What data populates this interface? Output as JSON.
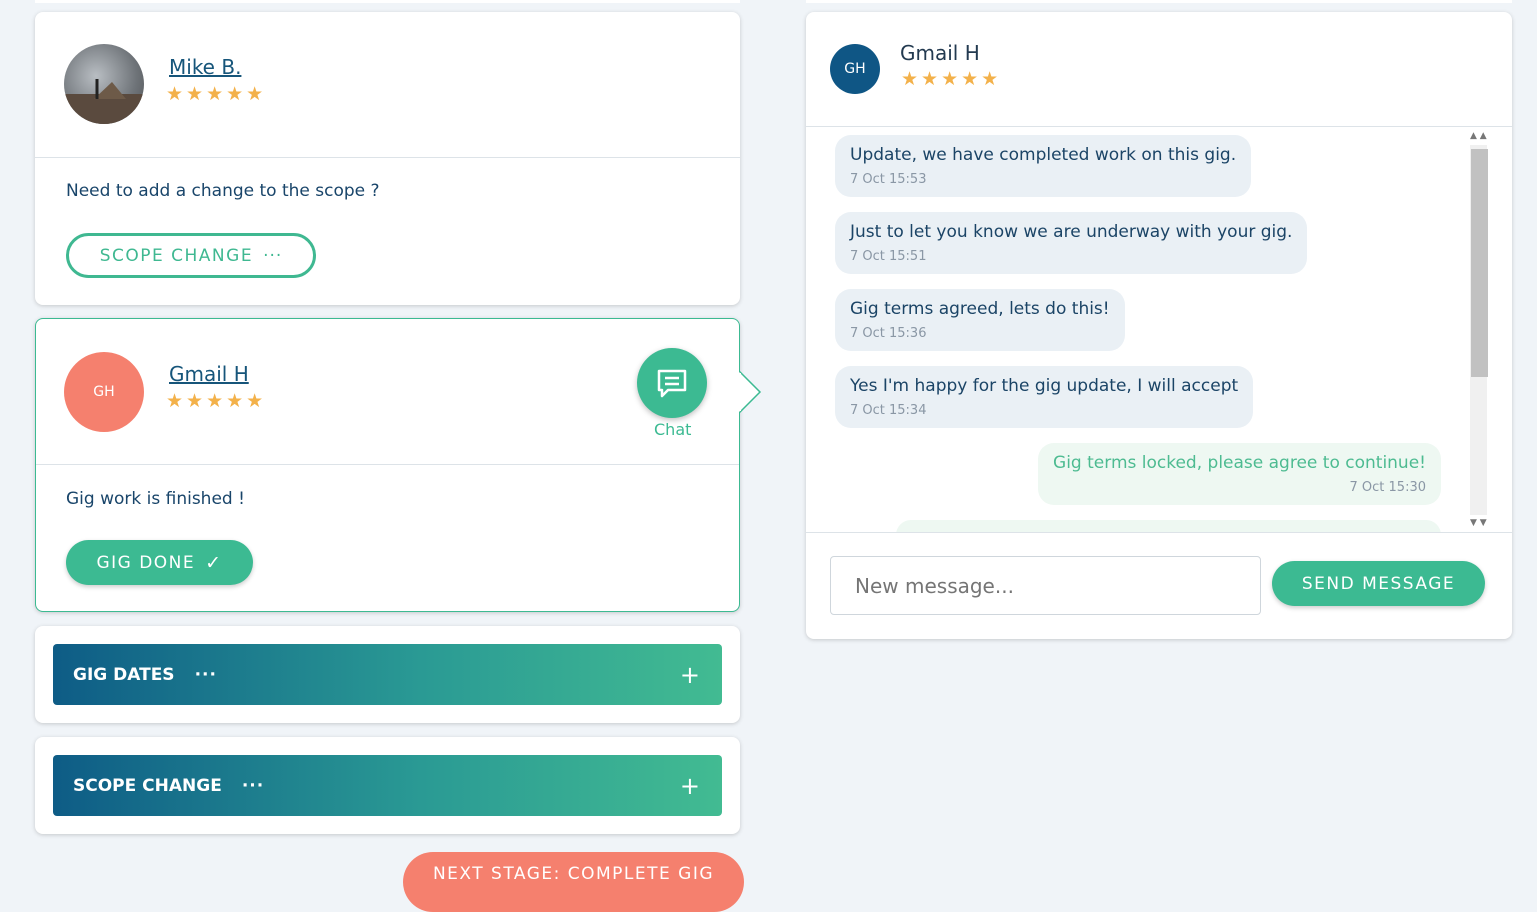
{
  "user_card": {
    "name": "Mike B.",
    "stars": "★★★★★",
    "prompt": "Need to add a change to the scope ?",
    "button_label": "SCOPE CHANGE",
    "button_dots": "···"
  },
  "gig_card": {
    "avatar_initials": "GH",
    "name": "Gmail H",
    "stars": "★★★★★",
    "chat_label": "Chat",
    "status": "Gig work is finished !",
    "button_label": "GIG DONE",
    "button_check": "✓"
  },
  "sections": [
    {
      "label": "GIG DATES",
      "dots": "···",
      "plus": "+"
    },
    {
      "label": "SCOPE CHANGE",
      "dots": "···",
      "plus": "+"
    }
  ],
  "next_stage_label": "NEXT STAGE: COMPLETE GIG",
  "chat": {
    "avatar_initials": "GH",
    "name": "Gmail H",
    "stars": "★★★★★",
    "messages": [
      {
        "text": "Update, we have completed work on this gig.",
        "time": "7 Oct 15:53",
        "direction": "received"
      },
      {
        "text": "Just to let you know we are underway with your gig.",
        "time": "7 Oct 15:51",
        "direction": "received"
      },
      {
        "text": "Gig terms agreed, lets do this!",
        "time": "7 Oct 15:36",
        "direction": "received"
      },
      {
        "text": "Yes I'm happy for the gig update, I will accept",
        "time": "7 Oct 15:34",
        "direction": "received"
      },
      {
        "text": "Gig terms locked, please agree to continue!",
        "time": "7 Oct 15:30",
        "direction": "sent"
      }
    ],
    "input_placeholder": "New message...",
    "send_label": "SEND MESSAGE"
  },
  "colors": {
    "accent_green": "#3cba92",
    "navy": "#0e5c86",
    "salmon": "#f5806e",
    "star": "#f3b14a"
  }
}
